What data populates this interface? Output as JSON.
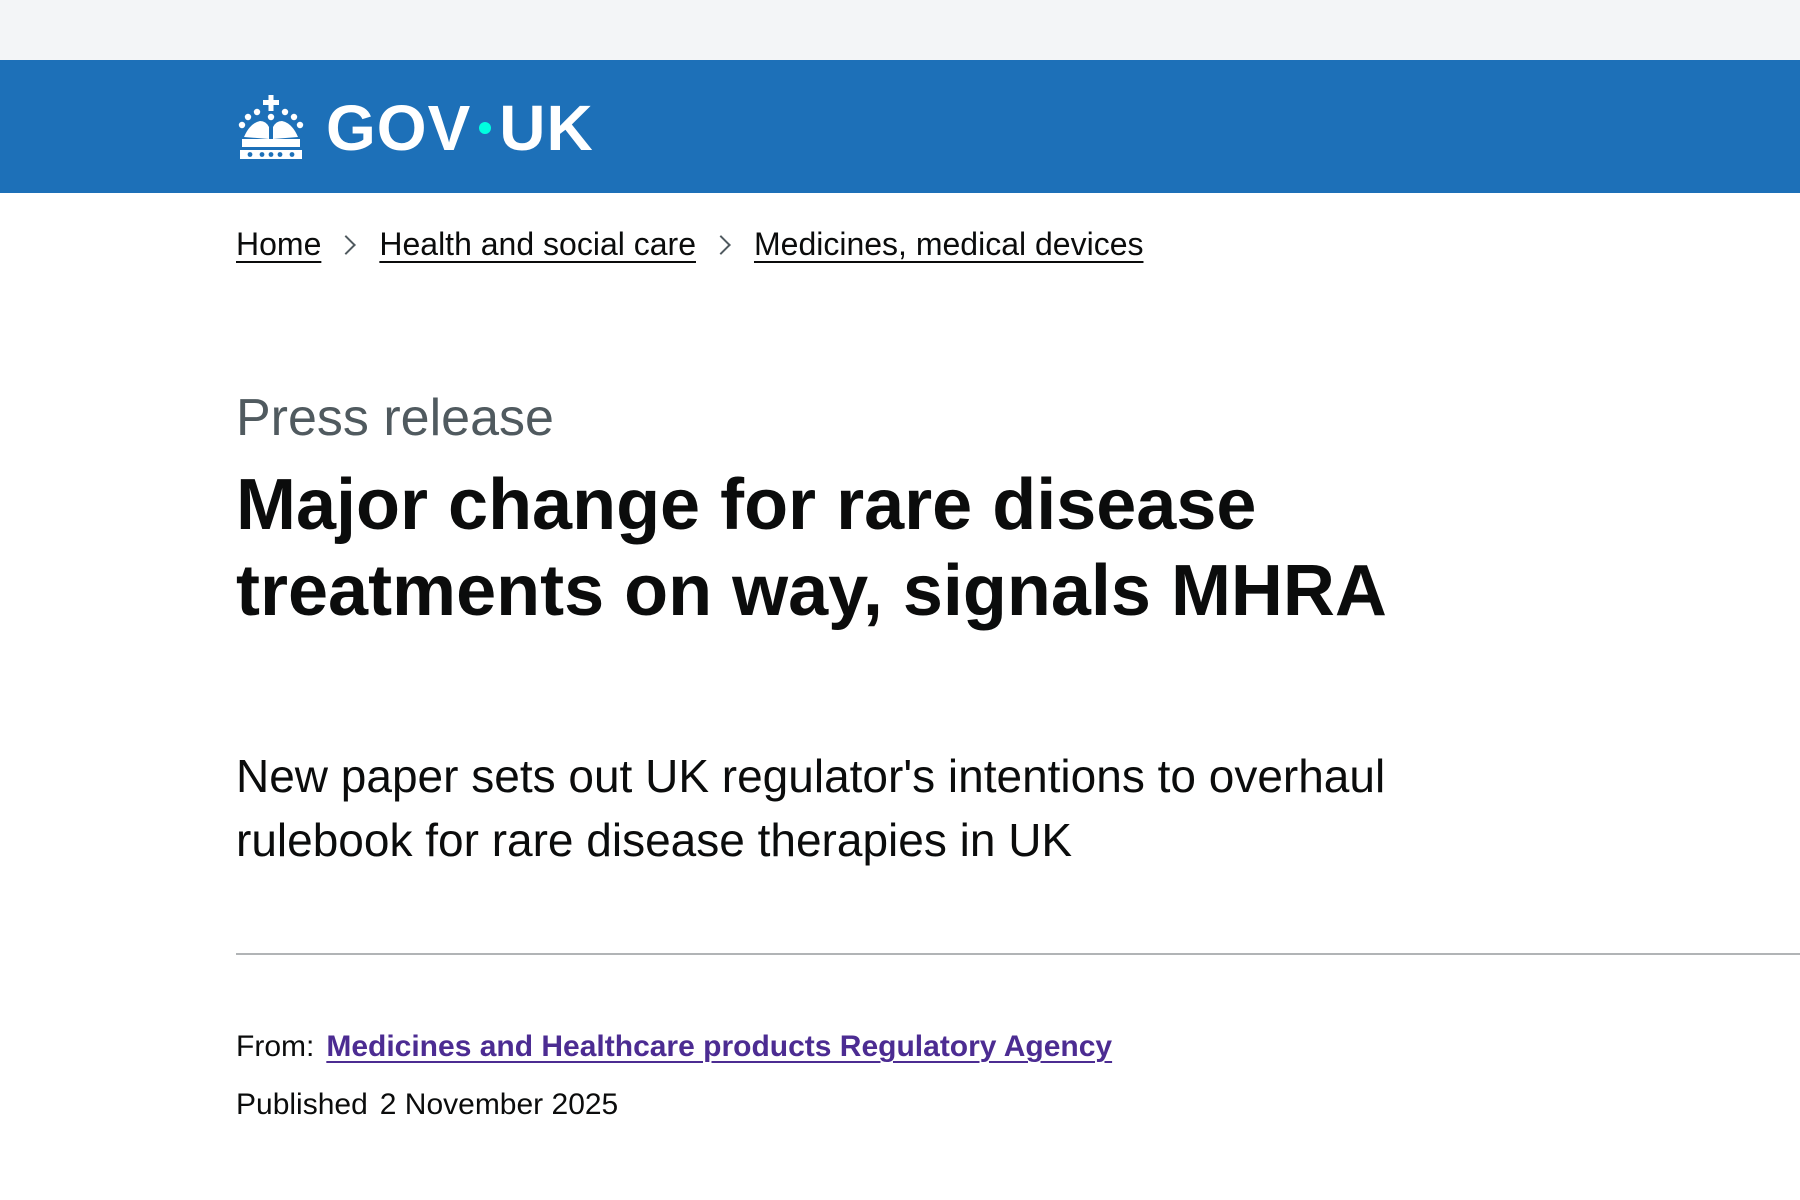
{
  "header": {
    "logo_text_left": "GOV",
    "logo_text_right": "UK",
    "crown_icon": "crown-icon",
    "colors": {
      "background": "#1d70b8",
      "logo_dot": "#00ffe0"
    }
  },
  "breadcrumb": {
    "items": [
      {
        "label": "Home"
      },
      {
        "label": "Health and social care"
      },
      {
        "label": "Medicines, medical devices"
      }
    ],
    "separator_icon": "chevron-right-icon"
  },
  "article": {
    "caption": "Press release",
    "title": "Major change for rare disease treatments on way, signals MHRA",
    "lede": "New paper sets out UK regulator's intentions to overhaul rulebook for rare disease therapies in UK"
  },
  "metadata": {
    "from_label": "From:",
    "organisation": "Medicines and Healthcare products Regulatory Agency",
    "published_label": "Published",
    "published_date": "2 November 2025",
    "colors": {
      "link_visited": "#4c2c92"
    }
  }
}
